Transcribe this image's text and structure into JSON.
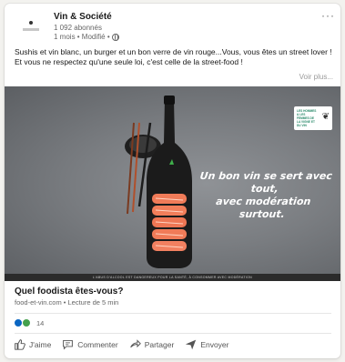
{
  "post": {
    "author": "Vin & Société",
    "followers": "1 092 abonnés",
    "meta": "1 mois • Modifié •",
    "more_label": "···",
    "text": "Sushis et vin blanc, un burger et un bon verre de vin rouge...Vous, vous êtes un street lover ! Et vous ne respectez qu'une seule loi, c'est celle de la street-food !",
    "see_more": "Voir plus..."
  },
  "image": {
    "slogan_line1": "Un bon vin se sert avec tout,",
    "slogan_line2": "avec modération surtout.",
    "brand": "LES HOMMES & LES FEMMES DE LA VIGNE ET DU VIN",
    "legal": "L'ABUS D'ALCOOL EST DANGEREUX POUR LA SANTÉ, À CONSOMMER AVEC MODÉRATION"
  },
  "article": {
    "title": "Quel foodista êtes-vous?",
    "subtitle": "food-et-vin.com • Lecture de 5 min"
  },
  "reactions": {
    "count": "14"
  },
  "actions": [
    {
      "label": "J'aime",
      "icon": "thumbs-up-icon"
    },
    {
      "label": "Commenter",
      "icon": "comment-icon"
    },
    {
      "label": "Partager",
      "icon": "share-icon"
    },
    {
      "label": "Envoyer",
      "icon": "send-icon"
    }
  ],
  "colors": {
    "like_blue": "#0a66c2",
    "celebrate_green": "#44a04d",
    "salmon": "#f07b58"
  }
}
